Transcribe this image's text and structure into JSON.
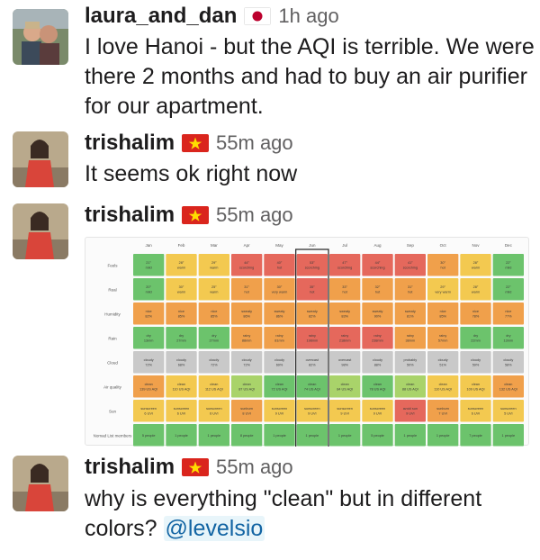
{
  "messages": [
    {
      "author": "laura_and_dan",
      "flag": "japan-flag-icon",
      "time": "1h ago",
      "text": "I love Hanoi - but the AQI is terrible.  We were there 2 months and had to buy an air purifier for our apartment."
    },
    {
      "author": "trishalim",
      "flag": "vietnam-flag-icon",
      "time": "55m ago",
      "text": "It seems ok right now"
    },
    {
      "author": "trishalim",
      "flag": "vietnam-flag-icon",
      "time": "55m ago",
      "text": ""
    },
    {
      "author": "trishalim",
      "flag": "vietnam-flag-icon",
      "time": "55m ago",
      "text_before": "why is everything \"clean\" but in different colors? ",
      "mention": "@levelsio"
    }
  ],
  "colors": {
    "green": "#6cc36c",
    "light_green": "#a9d36a",
    "yellow": "#f3c950",
    "orange": "#f0a04b",
    "red": "#e5685c",
    "gray": "#c9c9c9",
    "mention_blue": "#1264a3"
  },
  "chart_data": {
    "type": "heatmap",
    "months": [
      "Jan",
      "Feb",
      "Mar",
      "Apr",
      "May",
      "Jun",
      "Jul",
      "Aug",
      "Sep",
      "Oct",
      "Nov",
      "Dec"
    ],
    "highlighted_month": "Jun",
    "rows": [
      {
        "label": "Feels",
        "values": [
          "21°|mild",
          "28°|warm",
          "29°|warm",
          "44°|scorching",
          "40°|hot",
          "53°|scorching",
          "47°|scorching",
          "44°|scorching",
          "41°|scorching",
          "30°|hot",
          "28°|warm",
          "22°|mild"
        ],
        "colors": [
          "green",
          "yellow",
          "yellow",
          "red",
          "red",
          "red",
          "red",
          "red",
          "red",
          "orange",
          "yellow",
          "green"
        ]
      },
      {
        "label": "Real",
        "values": [
          "20°|mild",
          "30°|warm",
          "25°|warm",
          "31°|hot",
          "30°|very warm",
          "35°|hot",
          "33°|hot",
          "32°|hot",
          "31°|hot",
          "29°|very warm",
          "28°|warm",
          "22°|mild"
        ],
        "colors": [
          "green",
          "yellow",
          "yellow",
          "orange",
          "orange",
          "red",
          "orange",
          "orange",
          "orange",
          "yellow",
          "yellow",
          "green"
        ]
      },
      {
        "label": "Humidity",
        "values": [
          "nice|82%",
          "nice|85%",
          "nice|85%",
          "sweaty|86%",
          "sweaty|86%",
          "sweaty|82%",
          "sweaty|83%",
          "sweaty|90%",
          "sweaty|81%",
          "nice|85%",
          "nice|78%",
          "nice|77%"
        ],
        "colors": [
          "orange",
          "orange",
          "orange",
          "orange",
          "orange",
          "orange",
          "orange",
          "orange",
          "orange",
          "orange",
          "orange",
          "orange"
        ]
      },
      {
        "label": "Rain",
        "values": [
          "dry|13mm",
          "dry|27mm",
          "dry|27mm",
          "rainy|88mm",
          "rainy|81mm",
          "rainy|198mm",
          "rainy|218mm",
          "rainy|238mm",
          "rainy|38mm",
          "rainy|57mm",
          "dry|22mm",
          "dry|13mm"
        ],
        "colors": [
          "green",
          "green",
          "green",
          "orange",
          "orange",
          "red",
          "red",
          "red",
          "orange",
          "orange",
          "green",
          "green"
        ]
      },
      {
        "label": "Cloud",
        "values": [
          "cloudy|72%",
          "cloudy|68%",
          "cloudy|72%",
          "cloudy|72%",
          "cloudy|69%",
          "overcast|82%",
          "overcast|98%",
          "cloudy|88%",
          "probably|50%",
          "cloudy|51%",
          "cloudy|59%",
          "cloudy|58%"
        ],
        "colors": [
          "gray",
          "gray",
          "gray",
          "gray",
          "gray",
          "gray",
          "gray",
          "gray",
          "gray",
          "gray",
          "gray",
          "gray"
        ]
      },
      {
        "label": "Air quality",
        "values": [
          "clean|139 US AQI",
          "clean|110 US AQI",
          "clean|112 US AQI",
          "clean|87 US AQI",
          "clean|72 US AQI",
          "clean|74 US AQI",
          "clean|84 US AQI",
          "clean|78 US AQI",
          "clean|88 US AQI",
          "clean|110 US AQI",
          "clean|109 US AQI",
          "clean|132 US AQI"
        ],
        "colors": [
          "orange",
          "yellow",
          "yellow",
          "light_green",
          "green",
          "green",
          "light_green",
          "green",
          "light_green",
          "yellow",
          "yellow",
          "orange"
        ]
      },
      {
        "label": "Sun",
        "values": [
          "sunscreen|6 UVI",
          "sunscreen|6 UVI",
          "sunscreen|6 UVI",
          "sunburn|8 UVI",
          "sunscreen|9 UVI",
          "sunscreen|9 UVI",
          "sunscreen|9 UVI",
          "sunscreen|9 UVI",
          "avoid sun|9 UVI",
          "sunburn|7 UVI",
          "sunscreen|6 UVI",
          "sunscreen|5 UVI"
        ],
        "colors": [
          "yellow",
          "yellow",
          "yellow",
          "orange",
          "yellow",
          "yellow",
          "yellow",
          "yellow",
          "red",
          "orange",
          "yellow",
          "yellow"
        ]
      },
      {
        "label": "Nomad List members",
        "values": [
          "5 people",
          "1 people",
          "1 people",
          "8 people",
          "1 people",
          "1 people",
          "1 people",
          "5 people",
          "1 people",
          "1 people",
          "7 people",
          "1 people"
        ],
        "colors": [
          "green",
          "green",
          "green",
          "green",
          "green",
          "green",
          "green",
          "green",
          "green",
          "green",
          "green",
          "green"
        ]
      }
    ]
  }
}
